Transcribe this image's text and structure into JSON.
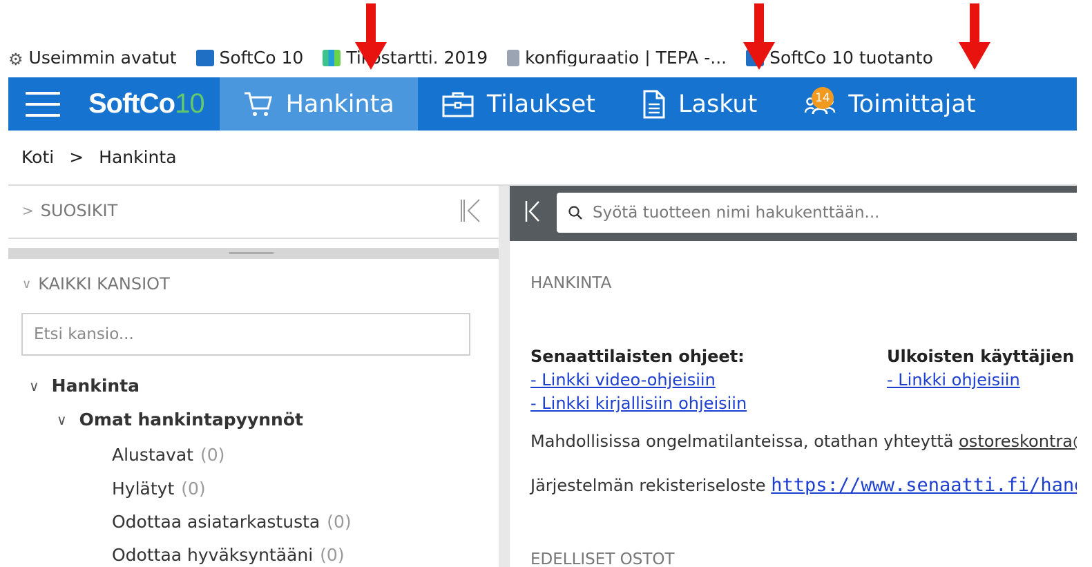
{
  "bookmarks": [
    {
      "label": "Useimmin avatut",
      "icon": "gear-icon"
    },
    {
      "label": "SoftCo 10",
      "icon": "softco-favicon"
    },
    {
      "label": "Tikostartti. 2019",
      "icon": "tiko-favicon"
    },
    {
      "label": "konfiguraatio | TEPA -...",
      "icon": "document-favicon"
    },
    {
      "label": "SoftCo 10 tuotanto",
      "icon": "softco-favicon"
    }
  ],
  "nav": {
    "logo_text": "SoftCo",
    "logo_number": "10",
    "items": [
      {
        "label": "Hankinta",
        "icon": "cart-icon",
        "active": true
      },
      {
        "label": "Tilaukset",
        "icon": "briefcase-icon"
      },
      {
        "label": "Laskut",
        "icon": "document-icon",
        "badge": "14"
      },
      {
        "label": "Toimittajat",
        "icon": "users-icon"
      }
    ],
    "colors": {
      "bar": "#1673cf",
      "active": "#4b97dd",
      "badge": "#f29a1f"
    }
  },
  "breadcrumb": {
    "home": "Koti",
    "separator": ">",
    "current": "Hankinta"
  },
  "left_panel": {
    "favorites_label": "SUOSIKIT",
    "all_folders_label": "KAIKKI KANSIOT",
    "folder_search_placeholder": "Etsi kansio...",
    "tree": {
      "root": "Hankinta",
      "sub": "Omat hankintapyynnöt",
      "items": [
        {
          "label": "Alustavat",
          "count": "(0)"
        },
        {
          "label": "Hylätyt",
          "count": "(0)"
        },
        {
          "label": "Odottaa asiatarkastusta",
          "count": "(0)"
        },
        {
          "label": "Odottaa hyväksyntääni",
          "count": "(0)"
        }
      ]
    }
  },
  "right_panel": {
    "search_placeholder": "Syötä tuotteen nimi hakukenttään...",
    "section_title": "HANKINTA",
    "col1_heading": "Senaattilaisten ohjeet:",
    "col1_links": [
      "- Linkki video-ohjeisiin",
      "- Linkki kirjallisiin ohjeisiin"
    ],
    "col2_heading": "Ulkoisten käyttäjien ohjeet:",
    "col2_link": "- Linkki ohjeisiin",
    "help_text": "Mahdollisissa ongelmatilanteissa, otathan yhteyttä",
    "help_email": "ostoreskontra@senaatti.fi",
    "privacy_text": "Järjestelmän rekisteriseloste",
    "privacy_link": "https://www.senaatti.fi/handi-ja-softco",
    "section2_title": "EDELLISET OSTOT"
  },
  "annotation_color": "#e8130f"
}
